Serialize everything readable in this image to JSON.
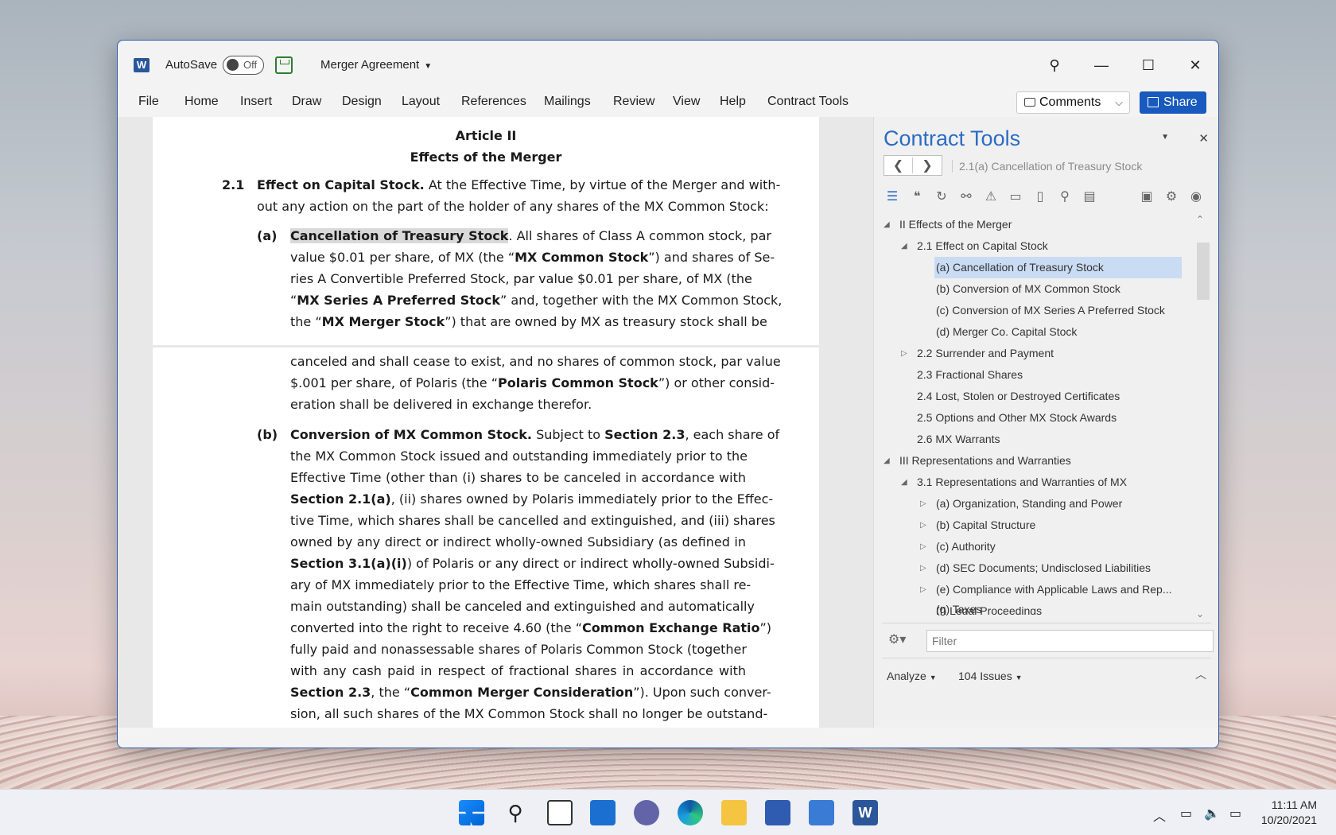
{
  "app": {
    "autosave_label": "AutoSave",
    "autosave_state": "Off",
    "document_title": "Merger Agreement"
  },
  "ribbon": {
    "tabs": [
      "File",
      "Home",
      "Insert",
      "Draw",
      "Design",
      "Layout",
      "References",
      "Mailings",
      "Review",
      "View",
      "Help",
      "Contract Tools"
    ],
    "comments_label": "Comments",
    "share_label": "Share"
  },
  "document": {
    "article": "Article II",
    "article_title": "Effects of the Merger",
    "s21_num": "2.1",
    "s21_head": "Effect on Capital Stock.",
    "s21_line1": " At the Effective Time, by virtue of the Merger and with-",
    "s21_line2": "out any action on the part of the holder of any shares of the MX Common Stock:",
    "a_label": "(a)",
    "a_head": "Cancellation of Treasury Stock",
    "a_l1_rest": ". All shares of Class A common stock, par",
    "a_l2_pre": "value $0.01 per share, of MX (the “",
    "a_l2_bold": "MX Common Stock",
    "a_l2_post": "”) and shares of Se-",
    "a_l3": "ries A Convertible Preferred Stock, par value $0.01 per share, of MX (the",
    "a_l4_pre": "“",
    "a_l4_bold": "MX Series A Preferred Stock",
    "a_l4_post": "” and, together with the MX Common Stock,",
    "a_l5_pre": "the “",
    "a_l5_bold": "MX Merger Stock",
    "a_l5_post": "”) that are owned by MX as treasury stock shall be",
    "a_l6": "canceled and shall cease to exist, and no shares of common stock, par value",
    "a_l7_pre": "$.001 per share, of Polaris (the “",
    "a_l7_bold": "Polaris Common Stock",
    "a_l7_post": "”) or other consid-",
    "a_l8": "eration shall be delivered in exchange therefor.",
    "b_label": "(b)",
    "b_head": "Conversion of MX Common Stock.",
    "b_l1_mid": " Subject to ",
    "b_l1_ref": "Section 2.3",
    "b_l1_post": ", each share of",
    "b_l2": "the MX Common Stock issued and outstanding immediately prior to the",
    "b_l3": "Effective Time (other than (i) shares to be canceled in accordance with",
    "b_l4_ref": "Section 2.1(a)",
    "b_l4_post": ", (ii) shares owned by Polaris immediately prior to the Effec-",
    "b_l5": "tive Time, which shares shall be cancelled and extinguished, and (iii) shares",
    "b_l6": "owned by any direct or indirect wholly-owned Subsidiary (as defined in",
    "b_l7_ref": "Section 3.1(a)(i)",
    "b_l7_post": ") of Polaris or any direct or indirect wholly-owned Subsidi-",
    "b_l8": "ary of MX immediately prior to the Effective Time, which shares shall re-",
    "b_l9": "main outstanding) shall be canceled and extinguished and automatically",
    "b_l10_pre": "converted into the right to receive 4.60 (the “",
    "b_l10_bold": "Common Exchange Ratio",
    "b_l10_post": "”)",
    "b_l11": "fully paid and nonassessable shares of Polaris Common Stock (together",
    "b_l12": "with any cash paid in respect of fractional shares in accordance with",
    "b_l13_ref": "Section 2.3",
    "b_l13_mid": ", the “",
    "b_l13_bold": "Common Merger Consideration",
    "b_l13_post": "”). Upon such conver-",
    "b_l14": "sion, all such shares of the MX Common Stock shall no longer be outstand-"
  },
  "pane": {
    "title": "Contract Tools",
    "breadcrumb": "2.1(a) Cancellation of Treasury Stock",
    "tree": [
      {
        "label": "II Effects of the Merger",
        "level": 0,
        "toggle": "◢"
      },
      {
        "label": "2.1 Effect on Capital Stock",
        "level": 1,
        "toggle": "◢"
      },
      {
        "label": "(a) Cancellation of Treasury Stock",
        "level": 2,
        "toggle": "",
        "selected": true
      },
      {
        "label": "(b) Conversion of MX Common Stock",
        "level": 2,
        "toggle": ""
      },
      {
        "label": "(c) Conversion of MX Series A Preferred Stock",
        "level": 2,
        "toggle": ""
      },
      {
        "label": "(d) Merger Co. Capital Stock",
        "level": 2,
        "toggle": ""
      },
      {
        "label": "2.2 Surrender and Payment",
        "level": 1,
        "toggle": "▷"
      },
      {
        "label": "2.3 Fractional Shares",
        "level": 1,
        "toggle": ""
      },
      {
        "label": "2.4 Lost, Stolen or Destroyed Certificates",
        "level": 1,
        "toggle": ""
      },
      {
        "label": "2.5 Options and Other MX Stock Awards",
        "level": 1,
        "toggle": ""
      },
      {
        "label": "2.6 MX Warrants",
        "level": 1,
        "toggle": ""
      },
      {
        "label": "III Representations and Warranties",
        "level": 0,
        "toggle": "◢"
      },
      {
        "label": "3.1 Representations and Warranties of MX",
        "level": 1,
        "toggle": "◢"
      },
      {
        "label": "(a) Organization, Standing and Power",
        "level": 2,
        "toggle": "▷"
      },
      {
        "label": "(b) Capital Structure",
        "level": 2,
        "toggle": "▷"
      },
      {
        "label": "(c) Authority",
        "level": 2,
        "toggle": "▷"
      },
      {
        "label": "(d) SEC Documents; Undisclosed Liabilities",
        "level": 2,
        "toggle": "▷"
      },
      {
        "label": "(e) Compliance with Applicable Laws and Rep...",
        "level": 2,
        "toggle": "▷"
      },
      {
        "label": "(f) Legal Proceedings",
        "level": 2,
        "toggle": ""
      },
      {
        "label": "(g) Taxes",
        "level": 2,
        "toggle": ""
      }
    ],
    "filter_placeholder": "Filter",
    "analyze_label": "Analyze",
    "issues_label": "104 Issues"
  },
  "taskbar": {
    "time": "11:11 AM",
    "date": "10/20/2021"
  },
  "colors": {
    "accent": "#2b6cc4",
    "share_button": "#185abd",
    "selection": "#c9dcf3"
  }
}
